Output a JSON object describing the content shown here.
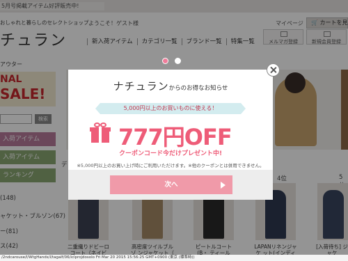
{
  "topbar": {
    "news": "5月号掲載アイテム好評販売中!"
  },
  "header": {
    "tagline": "おしゃれと暮らしのセレクトショップ",
    "logo": "チュラン",
    "welcome": "ようこそ！ゲスト様",
    "mypage": "マイページ",
    "cart_label": "カートを見る",
    "nav": [
      "新入荷アイテム",
      "カテゴリ一覧",
      "ブランド一覧",
      "特集一覧"
    ],
    "mail_signup": "メルマガ登録",
    "member_signup": "新規会員登録"
  },
  "breadcrumb": "アウター",
  "sale_banner": {
    "line1": "NAL",
    "line2": "SALE!"
  },
  "search": {
    "button": "検索"
  },
  "sidebar": {
    "cat1": "入荷アイテム",
    "cat2": "入荷アイテム",
    "cat3": "ランキング",
    "list": [
      "(148)",
      "ャケット・ブルゾン(67)",
      "ー(81)",
      "ス(42)"
    ]
  },
  "ranks": [
    "4位",
    "5位"
  ],
  "hero_label": "デ",
  "products": [
    {
      "title": "二重織りドビーロ コート（ネイビ"
    },
    {
      "title": "高密度ツイルブルゾ ンジャケット（"
    },
    {
      "title": "ピートルコート(B・ ティール"
    },
    {
      "title": "LAPANリネンジャケ ット(インディゴ"
    },
    {
      "title": "[入荷待ち] ジャケ"
    }
  ],
  "statusbar": "/2ndcarouse/l/WtgHands/l/tagalf/06/iclprojdosolo Fri Mar 20 2015 15:56:25 GMT+0900 (東京 (標準時))",
  "modal": {
    "brand": "ナチュラン",
    "title_rest": "からのお得なお知らせ",
    "ribbon": "5,000円以上のお買いものに使える！",
    "offer": "777円OFF",
    "coupon": "クーポンコード今だけプレゼント中!",
    "note": "※5,000円以上のお買い上げ時にご利用いただけます。※他のクーポンとは併用できません。",
    "next_label": "次へ",
    "page_dots": 2,
    "active_dot": 1
  },
  "colors": {
    "accent_pink": "#ee5c78",
    "button_pink": "#f09aa9",
    "ribbon_teal": "#d3ecef"
  }
}
